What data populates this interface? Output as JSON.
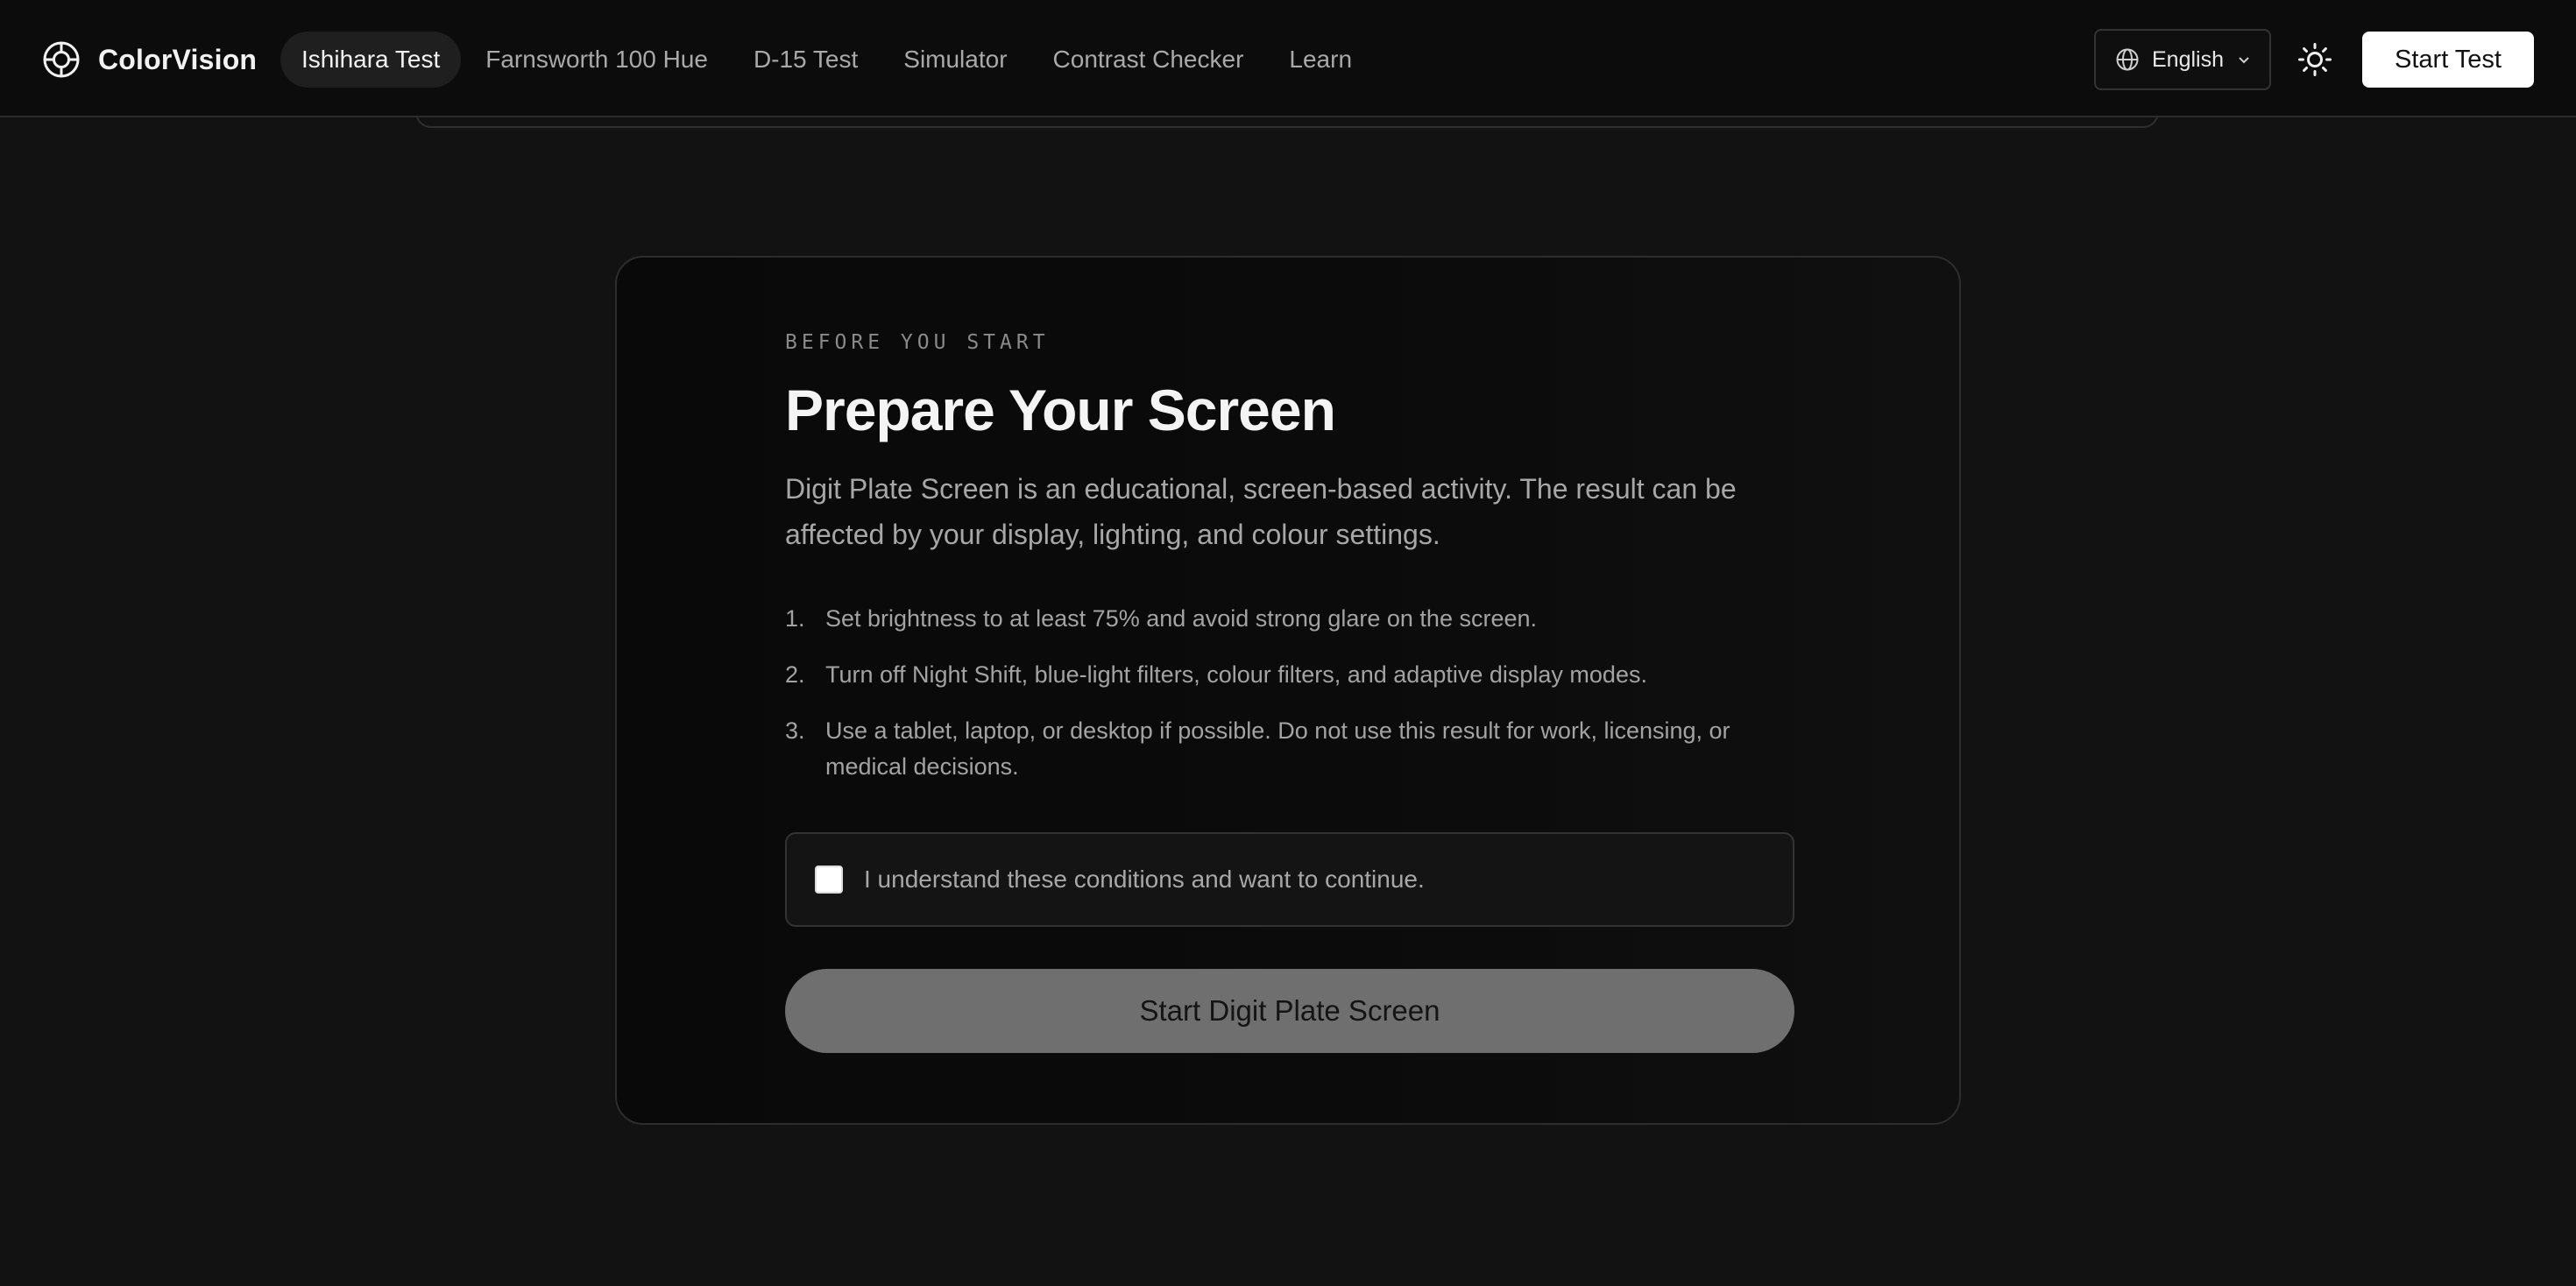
{
  "brand": {
    "name": "ColorVision"
  },
  "nav": {
    "items": [
      {
        "label": "Ishihara Test",
        "active": true
      },
      {
        "label": "Farnsworth 100 Hue",
        "active": false
      },
      {
        "label": "D-15 Test",
        "active": false
      },
      {
        "label": "Simulator",
        "active": false
      },
      {
        "label": "Contrast Checker",
        "active": false
      },
      {
        "label": "Learn",
        "active": false
      }
    ]
  },
  "header": {
    "language": "English",
    "start_test_label": "Start Test"
  },
  "card": {
    "eyebrow": "BEFORE YOU START",
    "title": "Prepare Your Screen",
    "intro": "Digit Plate Screen is an educational, screen-based activity. The result can be affected by your display, lighting, and colour settings.",
    "steps": [
      {
        "num": "1.",
        "text": "Set brightness to at least 75% and avoid strong glare on the screen."
      },
      {
        "num": "2.",
        "text": "Turn off Night Shift, blue-light filters, colour filters, and adaptive display modes."
      },
      {
        "num": "3.",
        "text": "Use a tablet, laptop, or desktop if possible. Do not use this result for work, licensing, or medical decisions."
      }
    ],
    "consent_label": "I understand these conditions and want to continue.",
    "consent_checked": false,
    "start_button_label": "Start Digit Plate Screen"
  },
  "colors": {
    "background": "#121212",
    "header_background": "#0c0c0c",
    "primary_button": "#ffffff",
    "disabled_button": "#6f6f6f"
  }
}
